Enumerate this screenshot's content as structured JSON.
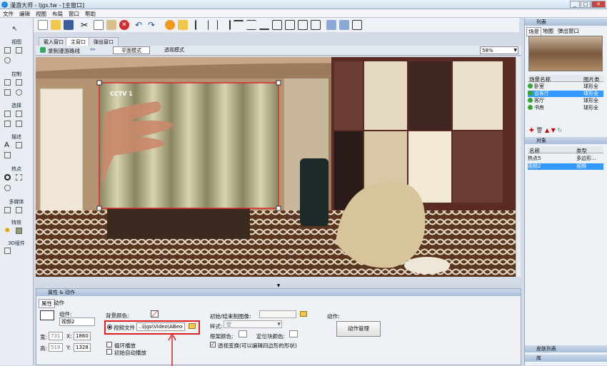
{
  "app": {
    "title": "漫游大师 - ljgs.tw - [主窗口]"
  },
  "menu": [
    "文件",
    "编辑",
    "视图",
    "布局",
    "窗口",
    "帮助"
  ],
  "palette": [
    "视图",
    "控制",
    "选择",
    "描述",
    "热点",
    "多媒体",
    "特效",
    "3D组件"
  ],
  "tabs": [
    "载入窗口",
    "主窗口",
    "弹出窗口"
  ],
  "subbar": {
    "record": "录制漫游路线",
    "mode_flat": "平面模式",
    "mode_persp": "透视模式",
    "zoom": "58%"
  },
  "viewport": {
    "tv_logo": "CCTV 1"
  },
  "props": {
    "header": "属性 & 动作",
    "tab_props": "属性",
    "tab_actions": "动作",
    "component_label": "组件:",
    "component_value": "视频2",
    "width_label": "宽:",
    "width_value": "731",
    "height_label": "高:",
    "height_value": "519",
    "x_label": "X:",
    "x_value": "1860",
    "y_label": "Y:",
    "y_value": "1328",
    "bg_color_label": "背景颜色:",
    "video_file_label": "视频文件",
    "video_file_value": "..\\ljgs\\Video\\ABeoChi",
    "loop_label": "循环播放",
    "autoplay_label": "初始自动播放",
    "init_image_label": "初始/结束制图像:",
    "style_label": "样式:",
    "style_value": "空",
    "border_color_label": "框架颜色:",
    "pos_color_label": "定位块颜色:",
    "perspective_label": "透视变换(可以编辑四边形的形状)",
    "action_label": "动作:",
    "action_button": "动作管理"
  },
  "right": {
    "list_header": "列表",
    "tabs": [
      "场景",
      "地图",
      "弹出窗口"
    ],
    "scene_cols": [
      "场景名称",
      "图片类"
    ],
    "scenes": [
      {
        "name": "卧室",
        "type": "球形全"
      },
      {
        "name": "会客厅",
        "type": "球形全"
      },
      {
        "name": "客厅",
        "type": "球形全"
      },
      {
        "name": "书房",
        "type": "球形全"
      }
    ],
    "objects_header": "对象",
    "obj_cols": [
      "名称",
      "类型"
    ],
    "objects": [
      {
        "name": "热点5",
        "type": "多边形..."
      },
      {
        "name": "视频2",
        "type": "视频"
      }
    ],
    "skin_header": "皮肤列表",
    "lib_header": "库"
  },
  "colors": {
    "accent": "#3a7bd5",
    "highlight": "#3399ff",
    "annot": "#e02020"
  }
}
